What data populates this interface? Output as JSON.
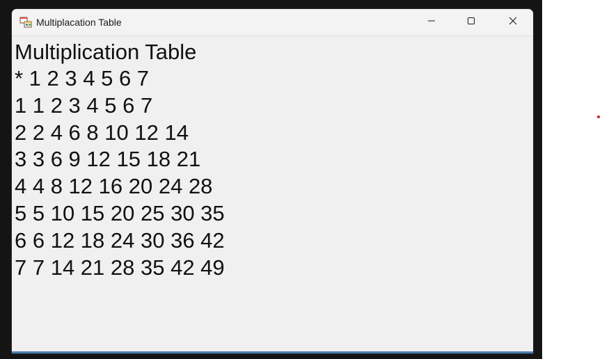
{
  "window": {
    "title": "Multiplacation Table",
    "app_icon": "winforms-app-icon",
    "controls": {
      "minimize_icon": "minimize-icon",
      "maximize_icon": "maximize-icon",
      "close_icon": "close-icon"
    }
  },
  "content": {
    "heading": "Multiplication Table",
    "rows": [
      "* 1 2 3 4 5 6 7",
      "1 1 2 3 4 5 6 7",
      "2 2 4 6 8 10 12 14",
      "3 3 6 9 12 15 18 21",
      "4 4 8 12 16 20 24 28",
      "5 5 10 15 20 25 30 35",
      "6 6 12 18 24 30 36 42",
      "7 7 14 21 28 35 42 49"
    ]
  },
  "colors": {
    "window_bg": "#f0f0f0",
    "titlebar_bg": "#f3f3f3",
    "desktop_bg": "#141414",
    "accent": "#4a7fb5",
    "dot": "#d11a1a"
  }
}
